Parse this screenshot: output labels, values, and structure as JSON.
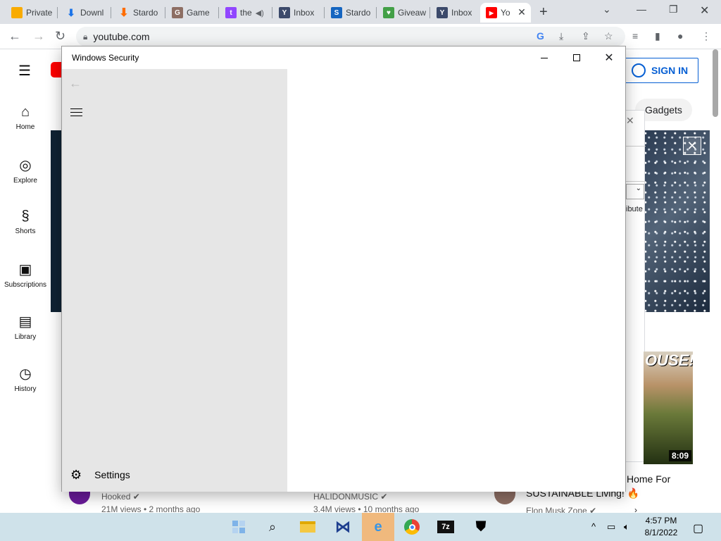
{
  "browser": {
    "tabs": [
      {
        "title": "Private",
        "icon": "google-keep-icon",
        "color": "#f9ab00"
      },
      {
        "title": "Downl",
        "icon": "download-icon",
        "color": "#1a73e8"
      },
      {
        "title": "Stardo",
        "icon": "stardock-arrow-icon",
        "color": "#ff6d00"
      },
      {
        "title": "Game",
        "icon": "game-icon",
        "color": "#5d4037"
      },
      {
        "title": "the",
        "icon": "twitch-icon",
        "color": "#9146ff"
      },
      {
        "title": "Inbox",
        "icon": "yahoo-mail-icon",
        "color": "#3c4a6b"
      },
      {
        "title": "Stardo",
        "icon": "stardock-icon",
        "color": "#1565c0"
      },
      {
        "title": "Giveaw",
        "icon": "giveaway-icon",
        "color": "#e53935"
      },
      {
        "title": "Inbox",
        "icon": "yahoo-mail-icon",
        "color": "#3c4a6b"
      },
      {
        "title": "Yo",
        "icon": "youtube-icon",
        "color": "#ff0000"
      }
    ],
    "url": "youtube.com"
  },
  "youtube": {
    "sidebar": [
      {
        "label": "Home",
        "icon": "home-icon"
      },
      {
        "label": "Explore",
        "icon": "compass-icon"
      },
      {
        "label": "Shorts",
        "icon": "shorts-icon"
      },
      {
        "label": "Subscriptions",
        "icon": "subscriptions-icon"
      },
      {
        "label": "Library",
        "icon": "library-icon"
      },
      {
        "label": "History",
        "icon": "history-icon"
      }
    ],
    "sign_in": "SIGN IN",
    "chip": "Gadgets",
    "popup_partial_text": "ibute",
    "videos": [
      {
        "channel": "Hooked",
        "stats": "21M views • 2 months ago"
      },
      {
        "channel": "HALIDONMUSIC",
        "stats": "3.4M views • 10 months ago"
      },
      {
        "title_line1": "Home For",
        "title_line2": "SUSTAINABLE Living! 🔥",
        "channel": "Elon Musk Zone",
        "thumb_text": "OUSE!",
        "duration": "8:09"
      }
    ]
  },
  "windows_security": {
    "title": "Windows Security",
    "nav_settings": "Settings"
  },
  "taskbar": {
    "apps": [
      "task-view-icon",
      "search-icon",
      "file-explorer-icon",
      "visual-studio-icon",
      "internet-explorer-icon",
      "chrome-icon",
      "7zip-icon",
      "windows-security-icon"
    ],
    "time": "4:57 PM",
    "date": "8/1/2022"
  }
}
